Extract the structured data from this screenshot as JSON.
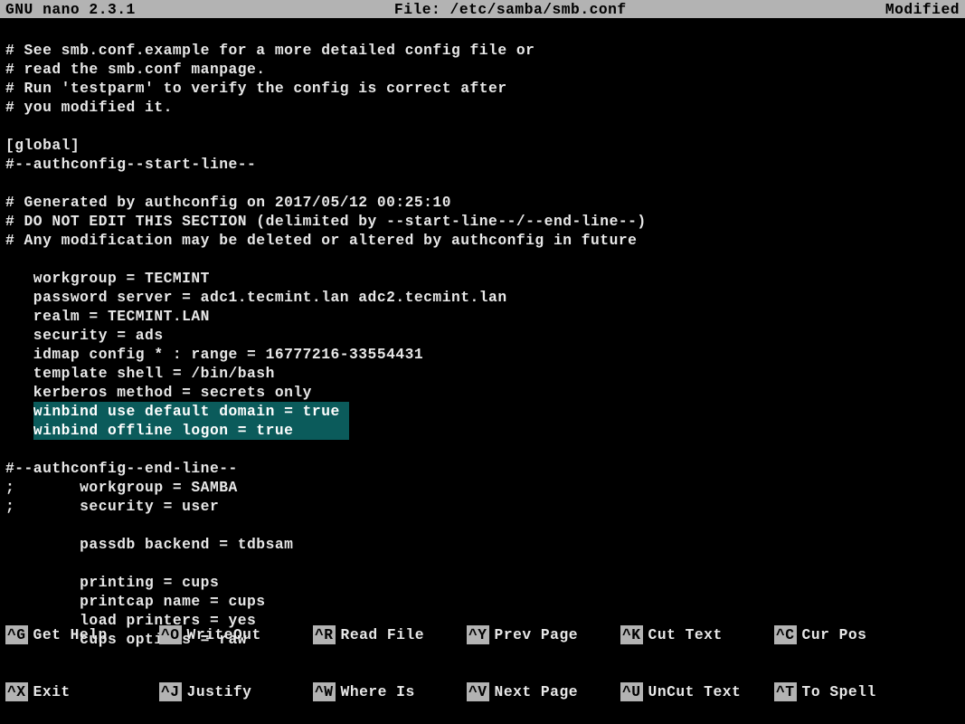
{
  "title": {
    "left": "GNU nano 2.3.1",
    "center": "File: /etc/samba/smb.conf",
    "right": "Modified"
  },
  "lines": [
    {
      "t": ""
    },
    {
      "t": "# See smb.conf.example for a more detailed config file or"
    },
    {
      "t": "# read the smb.conf manpage."
    },
    {
      "t": "# Run 'testparm' to verify the config is correct after"
    },
    {
      "t": "# you modified it."
    },
    {
      "t": ""
    },
    {
      "t": "[global]"
    },
    {
      "t": "#--authconfig--start-line--"
    },
    {
      "t": ""
    },
    {
      "t": "# Generated by authconfig on 2017/05/12 00:25:10"
    },
    {
      "t": "# DO NOT EDIT THIS SECTION (delimited by --start-line--/--end-line--)"
    },
    {
      "t": "# Any modification may be deleted or altered by authconfig in future"
    },
    {
      "t": ""
    },
    {
      "t": "   workgroup = TECMINT"
    },
    {
      "t": "   password server = adc1.tecmint.lan adc2.tecmint.lan"
    },
    {
      "t": "   realm = TECMINT.LAN"
    },
    {
      "t": "   security = ads"
    },
    {
      "t": "   idmap config * : range = 16777216-33554431"
    },
    {
      "t": "   template shell = /bin/bash"
    },
    {
      "t": "   kerberos method = secrets only"
    },
    {
      "t": "   winbind use default domain = true ",
      "hl": true
    },
    {
      "t": "   winbind offline logon = true      ",
      "hl": true
    },
    {
      "t": ""
    },
    {
      "t": "#--authconfig--end-line--"
    },
    {
      "t": ";       workgroup = SAMBA"
    },
    {
      "t": ";       security = user"
    },
    {
      "t": ""
    },
    {
      "t": "        passdb backend = tdbsam"
    },
    {
      "t": ""
    },
    {
      "t": "        printing = cups"
    },
    {
      "t": "        printcap name = cups"
    },
    {
      "t": "        load printers = yes"
    },
    {
      "t": "        cups options = raw"
    }
  ],
  "shortcuts": {
    "row1": [
      {
        "k": "^G",
        "l": "Get Help"
      },
      {
        "k": "^O",
        "l": "WriteOut"
      },
      {
        "k": "^R",
        "l": "Read File"
      },
      {
        "k": "^Y",
        "l": "Prev Page"
      },
      {
        "k": "^K",
        "l": "Cut Text"
      },
      {
        "k": "^C",
        "l": "Cur Pos"
      }
    ],
    "row2": [
      {
        "k": "^X",
        "l": "Exit"
      },
      {
        "k": "^J",
        "l": "Justify"
      },
      {
        "k": "^W",
        "l": "Where Is"
      },
      {
        "k": "^V",
        "l": "Next Page"
      },
      {
        "k": "^U",
        "l": "UnCut Text"
      },
      {
        "k": "^T",
        "l": "To Spell"
      }
    ]
  }
}
